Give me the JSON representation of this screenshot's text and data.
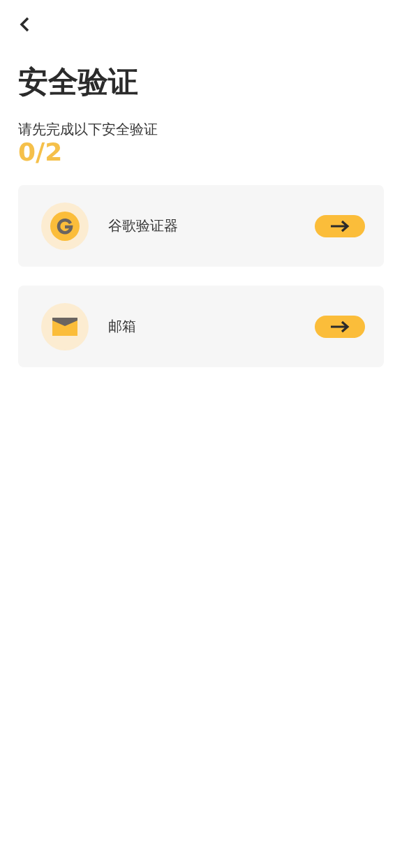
{
  "title": "安全验证",
  "subtitle": "请先完成以下安全验证",
  "progress": "0/2",
  "methods": [
    {
      "kind": "authenticator",
      "label": "谷歌验证器"
    },
    {
      "kind": "email",
      "label": "邮箱"
    }
  ]
}
